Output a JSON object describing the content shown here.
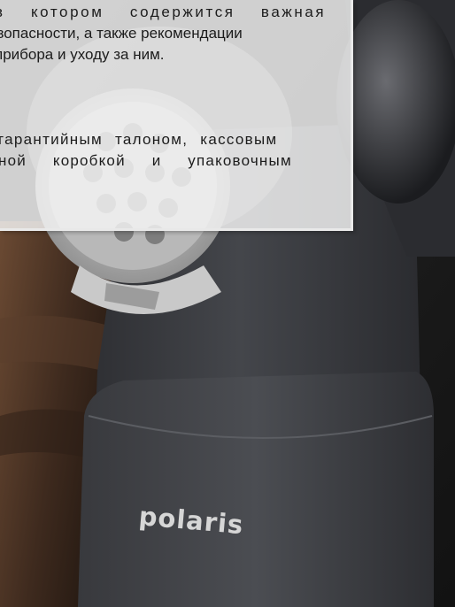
{
  "instruction_box": {
    "paragraph1": [
      "в котором содержится важная",
      "безопасности, а также рекомендации",
      "прибора и уходу за ним."
    ],
    "paragraph2": [
      "гарантийным талоном, кассовым",
      "ной коробкой и упаковочным"
    ]
  },
  "product": {
    "brand_logo": "polaris"
  }
}
